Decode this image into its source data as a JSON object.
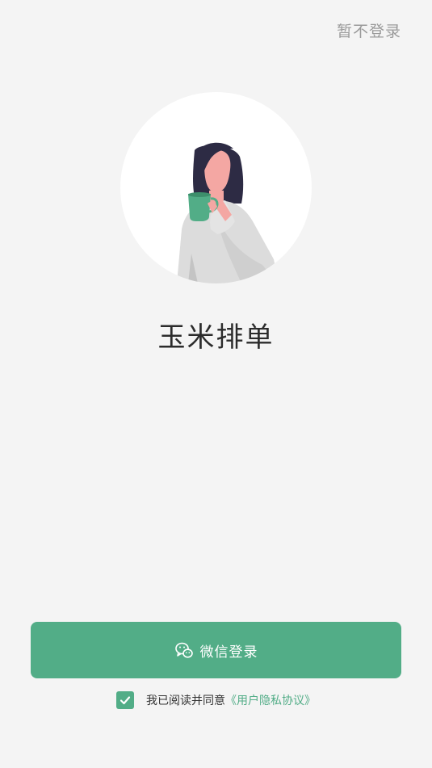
{
  "header": {
    "skip_label": "暂不登录"
  },
  "app": {
    "name": "玉米排单"
  },
  "login": {
    "wechat_label": "微信登录",
    "wechat_icon": "wechat-icon"
  },
  "agreement": {
    "checked": true,
    "prefix": "我已阅读并同意",
    "link_label": "《用户隐私协议》"
  },
  "colors": {
    "accent": "#52ad87",
    "background": "#f4f4f4",
    "muted_text": "#9a9a9a",
    "title_text": "#2b2b2b"
  }
}
